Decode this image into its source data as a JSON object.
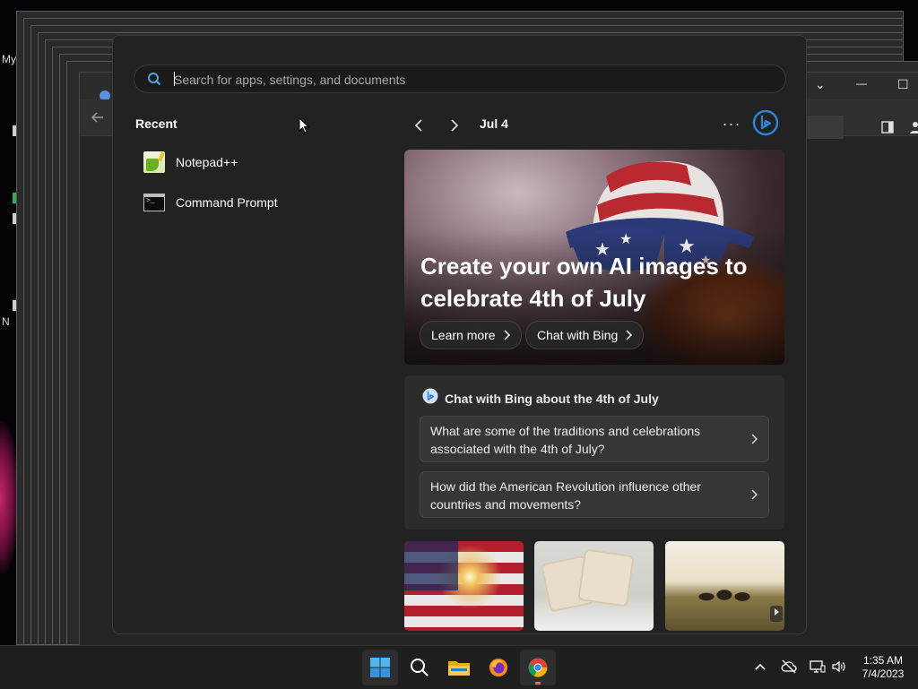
{
  "desktop": {
    "labels": [
      "My",
      "N"
    ]
  },
  "background_window": {
    "controls": {
      "dropdown": "⌄",
      "minimize": "—",
      "maximize": "☐"
    }
  },
  "start_menu": {
    "search": {
      "placeholder": "Search for apps, settings, and documents",
      "value": ""
    },
    "recent": {
      "title": "Recent",
      "items": [
        {
          "label": "Notepad++",
          "icon": "notepad-plus-plus-icon"
        },
        {
          "label": "Command Prompt",
          "icon": "command-prompt-icon"
        }
      ]
    },
    "widget": {
      "date": "Jul 4",
      "more_label": "···",
      "hero": {
        "title": "Create your own AI images to celebrate 4th of July",
        "buttons": [
          {
            "label": "Learn more"
          },
          {
            "label": "Chat with Bing"
          }
        ]
      },
      "chat": {
        "title": "Chat with Bing about the 4th of July",
        "questions": [
          {
            "text": "What are some of the traditions and celebrations associated with the 4th of July?"
          },
          {
            "text": "How did the American Revolution influence other countries and movements?"
          }
        ]
      },
      "thumbnails": [
        {
          "icon": "sparkler-flag-image"
        },
        {
          "icon": "rice-krispie-treats-image"
        },
        {
          "icon": "people-with-flag-image"
        }
      ]
    }
  },
  "taskbar": {
    "apps": [
      {
        "icon": "windows-start-icon",
        "active": true
      },
      {
        "icon": "search-icon"
      },
      {
        "icon": "file-explorer-icon"
      },
      {
        "icon": "firefox-icon"
      },
      {
        "icon": "chrome-icon",
        "active": true
      }
    ],
    "tray": {
      "chevron": "^",
      "time": "1:35 AM",
      "date": "7/4/2023"
    }
  },
  "colors": {
    "accent": "#4fa3e0",
    "start_bg": "#222222",
    "taskbar_bg": "#1f1f1f"
  }
}
